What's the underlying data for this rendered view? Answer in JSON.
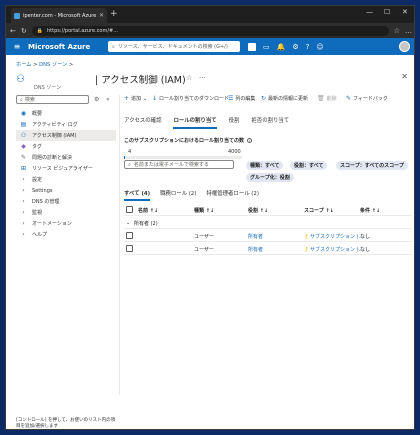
{
  "browser": {
    "tab_title": "ipenter.com - Microsoft Azure",
    "url": "https://portal.azure.com/#..."
  },
  "azure": {
    "brand": "Microsoft Azure",
    "search_placeholder": "リソース、サービス、ドキュメントの検索 (G+/)"
  },
  "breadcrumb": {
    "home": "ホーム",
    "sep": ">",
    "dns": "DNS ゾーン",
    "sep2": ">"
  },
  "blade": {
    "title": "| アクセス制御 (IAM)",
    "subtitle": "DNS ゾーン",
    "star": "☆",
    "more": "···",
    "close": "✕"
  },
  "sidebar": {
    "search_placeholder": "検索",
    "items": [
      {
        "label": "概要",
        "icon": "overview-icon"
      },
      {
        "label": "アクティビティ ログ",
        "icon": "activity-log-icon"
      },
      {
        "label": "アクセス制御 (IAM)",
        "icon": "iam-icon"
      },
      {
        "label": "タグ",
        "icon": "tag-icon"
      },
      {
        "label": "問題の診断と解決",
        "icon": "diagnose-icon"
      },
      {
        "label": "リソース ビジュアライザー",
        "icon": "visualizer-icon"
      },
      {
        "label": "設定"
      },
      {
        "label": "Settings"
      },
      {
        "label": "DNS の管理"
      },
      {
        "label": "監視"
      },
      {
        "label": "オートメーション"
      },
      {
        "label": "ヘルプ"
      }
    ]
  },
  "toolbar": {
    "add": "追加",
    "download": "ロール割り当てのダウンロード",
    "edit_columns": "列の編集",
    "refresh": "最新の情報に更新",
    "delete": "削除",
    "feedback": "フィードバック"
  },
  "tabs": [
    "アクセスの確認",
    "ロールの割り当て",
    "役割",
    "拒否の割り当て"
  ],
  "limit": {
    "label": "このサブスクリプションにおけるロール割り当ての数",
    "current": "4",
    "max": "4000",
    "fraction": 0.001
  },
  "filter": {
    "search_placeholder": "名前または電子メールで検索する",
    "type": "種類：すべて",
    "role": "役割：すべて",
    "scope": "スコープ：すべてのスコープ",
    "group": "グループ化：役割"
  },
  "result_tabs": [
    "すべて (4)",
    "職務ロール (2)",
    "特権管理者ロール (2)"
  ],
  "table": {
    "columns": [
      "名前",
      "種類",
      "役割",
      "スコープ",
      "条件"
    ],
    "group_label": "所有者 (2)",
    "rows": [
      {
        "type": "ユーザー",
        "role": "所有者",
        "scope": "サブスクリプション (…",
        "condition": "なし"
      },
      {
        "type": "ユーザー",
        "role": "所有者",
        "scope": "サブスクリプション (…",
        "condition": "なし"
      }
    ]
  },
  "status_bar": "[コントロール] を押して、お使いのリスト内の項目を追加/選択します"
}
